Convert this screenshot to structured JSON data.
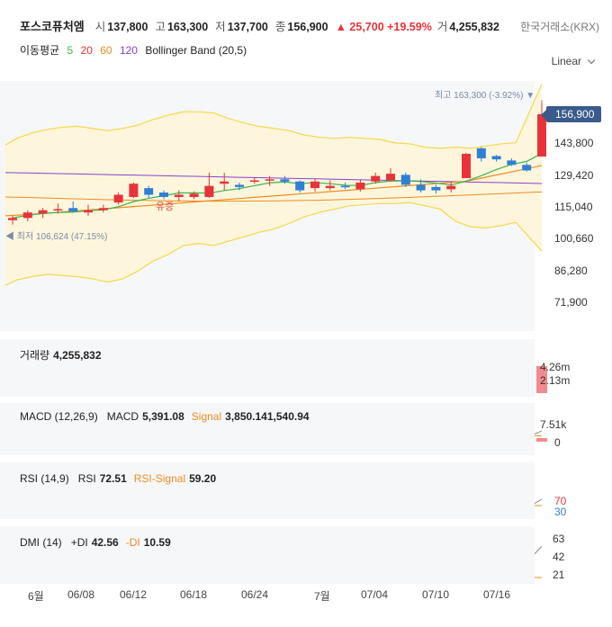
{
  "header": {
    "name": "포스코퓨처엠",
    "open_label": "시",
    "open": "137,800",
    "high_label": "고",
    "high": "163,300",
    "low_label": "저",
    "low": "137,700",
    "close_label": "종",
    "close": "156,900",
    "change": "▲ 25,700 +19.59%",
    "volume_label": "거",
    "volume": "4,255,832",
    "exchange": "한국거래소(KRX)"
  },
  "indicators": {
    "ma_label": "이동평균",
    "ma5": "5",
    "ma20": "20",
    "ma60": "60",
    "ma120": "120",
    "bb": "Bollinger Band (20,5)",
    "scale": "Linear"
  },
  "price_panel": {
    "axis": [
      "156,900",
      "143,800",
      "129,420",
      "115,040",
      "100,660",
      "86,280",
      "71,900"
    ],
    "high_note": "최고 163,300 (-3.92%) ▼",
    "low_note": "◀ 최저 106,624 (47.15%)",
    "event_note": "유증",
    "current": "156,900"
  },
  "volume_panel": {
    "title": "거래량",
    "value": "4,255,832",
    "axis": [
      "4.26m",
      "2.13m"
    ]
  },
  "macd_panel": {
    "title": "MACD (12,26,9)",
    "macd_label": "MACD",
    "macd": "5,391.08",
    "signal_label": "Signal",
    "signal": "3,850.141,540.94",
    "axis": [
      "7.51k",
      "0"
    ]
  },
  "rsi_panel": {
    "title": "RSI (14,9)",
    "rsi_label": "RSI",
    "rsi": "72.51",
    "sig_label": "RSI-Signal",
    "sig": "59.20",
    "axis": [
      "70",
      "30"
    ]
  },
  "dmi_panel": {
    "title": "DMI (14)",
    "pdi_label": "+DI",
    "pdi": "42.56",
    "mdi_label": "-DI",
    "mdi": "10.59",
    "axis": [
      "63",
      "42",
      "21"
    ]
  },
  "xaxis": [
    "6월",
    "06/08",
    "06/12",
    "06/18",
    "06/24",
    "7월",
    "07/04",
    "07/10",
    "07/16"
  ],
  "colors": {
    "up": "#e8333a",
    "down": "#2f7fd6",
    "ma5": "#3cb44b",
    "ma20": "#e8333a",
    "ma60": "#f08c1e",
    "ma120": "#8a3fd1",
    "bb": "#f5d94a"
  },
  "chart_data": {
    "type": "candlestick",
    "candles": [
      {
        "o": 109000,
        "h": 111000,
        "l": 107000,
        "c": 110000
      },
      {
        "o": 110000,
        "h": 113500,
        "l": 108500,
        "c": 112500
      },
      {
        "o": 112000,
        "h": 114500,
        "l": 110000,
        "c": 113500
      },
      {
        "o": 113500,
        "h": 116500,
        "l": 112000,
        "c": 114000
      },
      {
        "o": 114500,
        "h": 117500,
        "l": 112500,
        "c": 113000
      },
      {
        "o": 112500,
        "h": 116000,
        "l": 111000,
        "c": 113500
      },
      {
        "o": 113500,
        "h": 116000,
        "l": 112500,
        "c": 114500
      },
      {
        "o": 117000,
        "h": 121500,
        "l": 116000,
        "c": 120500
      },
      {
        "o": 119500,
        "h": 126000,
        "l": 119000,
        "c": 125500
      },
      {
        "o": 123500,
        "h": 124500,
        "l": 119000,
        "c": 120500
      },
      {
        "o": 121500,
        "h": 122500,
        "l": 118500,
        "c": 119500
      },
      {
        "o": 119500,
        "h": 122500,
        "l": 117500,
        "c": 120500
      },
      {
        "o": 119500,
        "h": 122000,
        "l": 118500,
        "c": 121000
      },
      {
        "o": 119500,
        "h": 130500,
        "l": 119000,
        "c": 124500
      },
      {
        "o": 125500,
        "h": 130500,
        "l": 122500,
        "c": 126500
      },
      {
        "o": 125000,
        "h": 126000,
        "l": 122500,
        "c": 124000
      },
      {
        "o": 126500,
        "h": 128500,
        "l": 125500,
        "c": 127000
      },
      {
        "o": 127000,
        "h": 129000,
        "l": 124500,
        "c": 127500
      },
      {
        "o": 127500,
        "h": 129000,
        "l": 125500,
        "c": 126500
      },
      {
        "o": 126500,
        "h": 127000,
        "l": 121500,
        "c": 122500
      },
      {
        "o": 123500,
        "h": 127500,
        "l": 122000,
        "c": 126500
      },
      {
        "o": 123500,
        "h": 127000,
        "l": 122500,
        "c": 124500
      },
      {
        "o": 124500,
        "h": 126000,
        "l": 123000,
        "c": 124000
      },
      {
        "o": 123000,
        "h": 127500,
        "l": 122000,
        "c": 126000
      },
      {
        "o": 126500,
        "h": 130500,
        "l": 125500,
        "c": 129000
      },
      {
        "o": 127000,
        "h": 132500,
        "l": 126500,
        "c": 130000
      },
      {
        "o": 129500,
        "h": 130500,
        "l": 124000,
        "c": 125000
      },
      {
        "o": 125000,
        "h": 127500,
        "l": 121500,
        "c": 122500
      },
      {
        "o": 124000,
        "h": 125000,
        "l": 121000,
        "c": 122500
      },
      {
        "o": 123000,
        "h": 126500,
        "l": 121500,
        "c": 124500
      },
      {
        "o": 128000,
        "h": 139500,
        "l": 128000,
        "c": 139000
      },
      {
        "o": 141500,
        "h": 142000,
        "l": 135500,
        "c": 137000
      },
      {
        "o": 138000,
        "h": 138500,
        "l": 135500,
        "c": 136500
      },
      {
        "o": 136000,
        "h": 137000,
        "l": 133500,
        "c": 134000
      },
      {
        "o": 134000,
        "h": 135000,
        "l": 131000,
        "c": 131500
      },
      {
        "o": 137800,
        "h": 163300,
        "l": 137700,
        "c": 156900
      }
    ],
    "volume": [
      0.18,
      0.22,
      0.16,
      0.14,
      0.18,
      0.17,
      0.15,
      0.19,
      0.28,
      0.17,
      0.16,
      0.15,
      0.18,
      0.21,
      0.19,
      0.16,
      0.15,
      0.16,
      0.14,
      0.18,
      0.15,
      0.16,
      0.14,
      0.18,
      0.21,
      0.19,
      0.15,
      0.16,
      0.14,
      0.18,
      0.33,
      0.21,
      0.17,
      0.16,
      0.19,
      4.26
    ]
  }
}
